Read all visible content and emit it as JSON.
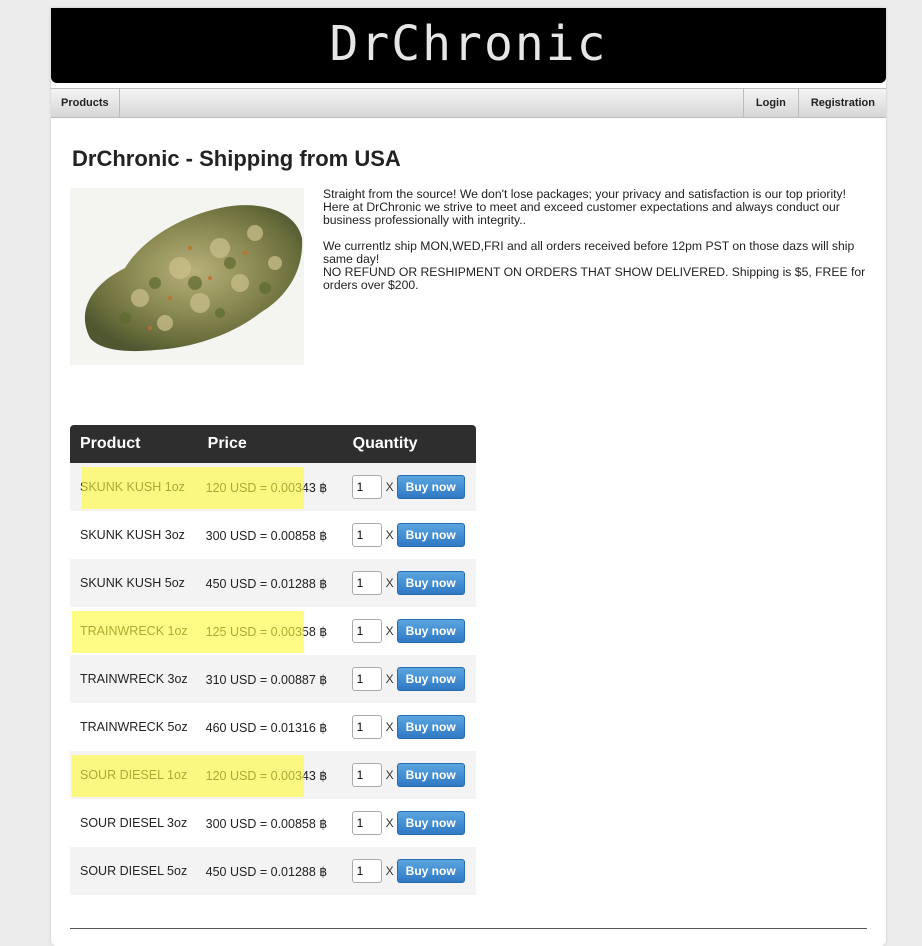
{
  "header": {
    "title": "DrChronic"
  },
  "nav": {
    "products": "Products",
    "login": "Login",
    "registration": "Registration"
  },
  "shop": {
    "title": "DrChronic - Shipping from USA",
    "image_alt": "cannabis bud",
    "intro": [
      "Straight from the source! We don't lose packages; your privacy and satisfaction is our top priority! Here at DrChronic we strive to meet and exceed customer expectations and always conduct our business professionally with integrity..",
      "We currentlz ship MON,WED,FRI and all orders received before 12pm PST on those dazs will ship same day!",
      "NO REFUND OR RESHIPMENT ON ORDERS THAT SHOW DELIVERED. Shipping is $5, FREE for orders over $200."
    ]
  },
  "table": {
    "headers": [
      "Product",
      "Price",
      "Quantity"
    ],
    "times_symbol": "X",
    "buy_label": "Buy now",
    "rows": [
      {
        "product": "SKUNK KUSH 1oz",
        "price": "120 USD = 0.00343 ฿",
        "qty": "1",
        "highlighted": true
      },
      {
        "product": "SKUNK KUSH 3oz",
        "price": "300 USD = 0.00858 ฿",
        "qty": "1",
        "highlighted": false
      },
      {
        "product": "SKUNK KUSH 5oz",
        "price": "450 USD = 0.01288 ฿",
        "qty": "1",
        "highlighted": false
      },
      {
        "product": "TRAINWRECK 1oz",
        "price": "125 USD = 0.00358 ฿",
        "qty": "1",
        "highlighted": true
      },
      {
        "product": "TRAINWRECK 3oz",
        "price": "310 USD = 0.00887 ฿",
        "qty": "1",
        "highlighted": false
      },
      {
        "product": "TRAINWRECK 5oz",
        "price": "460 USD = 0.01316 ฿",
        "qty": "1",
        "highlighted": false
      },
      {
        "product": "SOUR DIESEL 1oz",
        "price": "120 USD = 0.00343 ฿",
        "qty": "1",
        "highlighted": true
      },
      {
        "product": "SOUR DIESEL 3oz",
        "price": "300 USD = 0.00858 ฿",
        "qty": "1",
        "highlighted": false
      },
      {
        "product": "SOUR DIESEL 5oz",
        "price": "450 USD = 0.01288 ฿",
        "qty": "1",
        "highlighted": false
      }
    ]
  },
  "colors": {
    "banner_bg": "#000000",
    "table_header_bg": "#2e2e2e",
    "buy_button": "#2f78c4",
    "highlight": "#fffa3c"
  }
}
